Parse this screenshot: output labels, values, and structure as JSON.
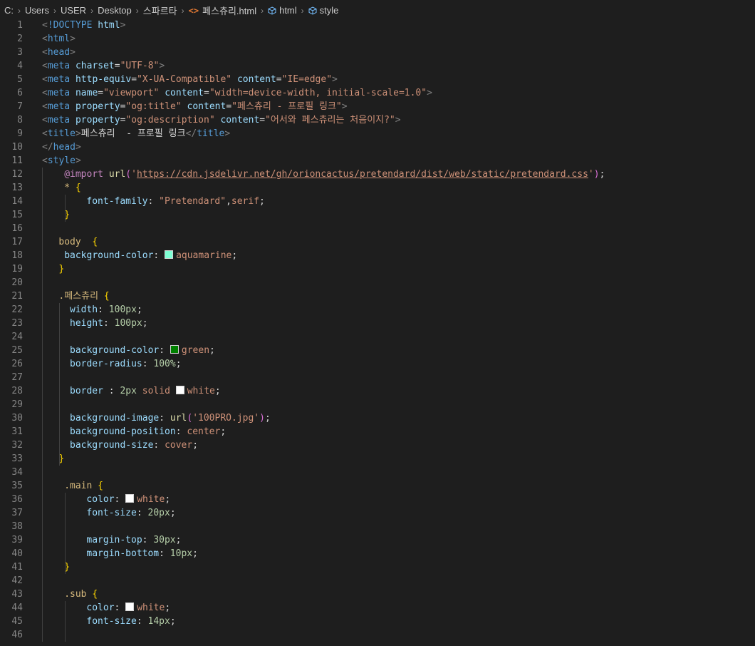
{
  "breadcrumb": {
    "items": [
      "C:",
      "Users",
      "USER",
      "Desktop",
      "스파르타",
      "페스츄리.html",
      "html",
      "style"
    ]
  },
  "colors": {
    "aquamarine": "#7fffd4",
    "green": "#008000",
    "white": "#ffffff"
  },
  "editor": {
    "lines": [
      {
        "n": "1",
        "indent": 0,
        "tokens": [
          [
            "t-tag",
            "<"
          ],
          [
            "t-tname",
            "!DOCTYPE"
          ],
          [
            "t-text",
            " "
          ],
          [
            "t-attr",
            "html"
          ],
          [
            "t-tag",
            ">"
          ]
        ]
      },
      {
        "n": "2",
        "indent": 0,
        "tokens": [
          [
            "t-tag",
            "<"
          ],
          [
            "t-tname",
            "html"
          ],
          [
            "t-tag",
            ">"
          ]
        ]
      },
      {
        "n": "3",
        "indent": 0,
        "tokens": [
          [
            "t-tag",
            "<"
          ],
          [
            "t-tname",
            "head"
          ],
          [
            "t-tag",
            ">"
          ]
        ]
      },
      {
        "n": "4",
        "indent": 0,
        "tokens": [
          [
            "t-tag",
            "<"
          ],
          [
            "t-tname",
            "meta"
          ],
          [
            "t-text",
            " "
          ],
          [
            "t-attr",
            "charset"
          ],
          [
            "t-text",
            "="
          ],
          [
            "t-str",
            "\"UTF-8\""
          ],
          [
            "t-tag",
            ">"
          ]
        ]
      },
      {
        "n": "5",
        "indent": 0,
        "tokens": [
          [
            "t-tag",
            "<"
          ],
          [
            "t-tname",
            "meta"
          ],
          [
            "t-text",
            " "
          ],
          [
            "t-attr",
            "http-equiv"
          ],
          [
            "t-text",
            "="
          ],
          [
            "t-str",
            "\"X-UA-Compatible\""
          ],
          [
            "t-text",
            " "
          ],
          [
            "t-attr",
            "content"
          ],
          [
            "t-text",
            "="
          ],
          [
            "t-str",
            "\"IE=edge\""
          ],
          [
            "t-tag",
            ">"
          ]
        ]
      },
      {
        "n": "6",
        "indent": 0,
        "tokens": [
          [
            "t-tag",
            "<"
          ],
          [
            "t-tname",
            "meta"
          ],
          [
            "t-text",
            " "
          ],
          [
            "t-attr",
            "name"
          ],
          [
            "t-text",
            "="
          ],
          [
            "t-str",
            "\"viewport\""
          ],
          [
            "t-text",
            " "
          ],
          [
            "t-attr",
            "content"
          ],
          [
            "t-text",
            "="
          ],
          [
            "t-str",
            "\"width=device-width, initial-scale=1.0\""
          ],
          [
            "t-tag",
            ">"
          ]
        ]
      },
      {
        "n": "7",
        "indent": 0,
        "tokens": [
          [
            "t-tag",
            "<"
          ],
          [
            "t-tname",
            "meta"
          ],
          [
            "t-text",
            " "
          ],
          [
            "t-attr",
            "property"
          ],
          [
            "t-text",
            "="
          ],
          [
            "t-str",
            "\"og:title\""
          ],
          [
            "t-text",
            " "
          ],
          [
            "t-attr",
            "content"
          ],
          [
            "t-text",
            "="
          ],
          [
            "t-str",
            "\"페스츄리 - 프로필 링크\""
          ],
          [
            "t-tag",
            ">"
          ]
        ]
      },
      {
        "n": "8",
        "indent": 0,
        "tokens": [
          [
            "t-tag",
            "<"
          ],
          [
            "t-tname",
            "meta"
          ],
          [
            "t-text",
            " "
          ],
          [
            "t-attr",
            "property"
          ],
          [
            "t-text",
            "="
          ],
          [
            "t-str",
            "\"og:description\""
          ],
          [
            "t-text",
            " "
          ],
          [
            "t-attr",
            "content"
          ],
          [
            "t-text",
            "="
          ],
          [
            "t-str",
            "\"어서와 페스츄리는 처음이지?\""
          ],
          [
            "t-tag",
            ">"
          ]
        ]
      },
      {
        "n": "9",
        "indent": 0,
        "tokens": [
          [
            "t-tag",
            "<"
          ],
          [
            "t-tname",
            "title"
          ],
          [
            "t-tag",
            ">"
          ],
          [
            "t-text",
            "페스츄리  - 프로필 링크"
          ],
          [
            "t-tag",
            "</"
          ],
          [
            "t-tname",
            "title"
          ],
          [
            "t-tag",
            ">"
          ]
        ]
      },
      {
        "n": "10",
        "indent": 0,
        "tokens": [
          [
            "t-tag",
            "</"
          ],
          [
            "t-tname",
            "head"
          ],
          [
            "t-tag",
            ">"
          ]
        ]
      },
      {
        "n": "11",
        "indent": 0,
        "tokens": [
          [
            "t-tag",
            "<"
          ],
          [
            "t-tname",
            "style"
          ],
          [
            "t-tag",
            ">"
          ]
        ]
      },
      {
        "n": "12",
        "indent": 4,
        "tokens": [
          [
            "t-at",
            "@import"
          ],
          [
            "t-text",
            " "
          ],
          [
            "t-fn",
            "url"
          ],
          [
            "t-brace2",
            "("
          ],
          [
            "t-str",
            "'"
          ],
          [
            "t-url",
            "https://cdn.jsdelivr.net/gh/orioncactus/pretendard/dist/web/static/pretendard.css"
          ],
          [
            "t-str",
            "'"
          ],
          [
            "t-brace2",
            ")"
          ],
          [
            "t-punc",
            ";"
          ]
        ]
      },
      {
        "n": "13",
        "indent": 4,
        "tokens": [
          [
            "t-star",
            "*"
          ],
          [
            "t-text",
            " "
          ],
          [
            "t-brace",
            "{"
          ]
        ]
      },
      {
        "n": "14",
        "indent": 8,
        "tokens": [
          [
            "t-prop",
            "font-family"
          ],
          [
            "t-punc",
            ": "
          ],
          [
            "t-val",
            "\"Pretendard\""
          ],
          [
            "t-punc",
            ","
          ],
          [
            "t-val",
            "serif"
          ],
          [
            "t-punc",
            ";"
          ]
        ]
      },
      {
        "n": "15",
        "indent": 4,
        "tokens": [
          [
            "t-brace",
            "}"
          ]
        ]
      },
      {
        "n": "16",
        "indent": 0,
        "tokens": []
      },
      {
        "n": "17",
        "indent": 3,
        "tokens": [
          [
            "t-sel",
            "body"
          ],
          [
            "t-text",
            "  "
          ],
          [
            "t-brace",
            "{"
          ]
        ]
      },
      {
        "n": "18",
        "indent": 4,
        "tokens": [
          [
            "t-prop",
            "background-color"
          ],
          [
            "t-punc",
            ": "
          ],
          [
            "swatch",
            "aquamarine"
          ],
          [
            "t-val",
            "aquamarine"
          ],
          [
            "t-punc",
            ";"
          ]
        ]
      },
      {
        "n": "19",
        "indent": 3,
        "tokens": [
          [
            "t-brace",
            "}"
          ]
        ]
      },
      {
        "n": "20",
        "indent": 0,
        "tokens": []
      },
      {
        "n": "21",
        "indent": 3,
        "tokens": [
          [
            "t-sel",
            ".페스츄리"
          ],
          [
            "t-text",
            " "
          ],
          [
            "t-brace",
            "{"
          ]
        ]
      },
      {
        "n": "22",
        "indent": 5,
        "tokens": [
          [
            "t-prop",
            "width"
          ],
          [
            "t-punc",
            ": "
          ],
          [
            "t-num",
            "100px"
          ],
          [
            "t-punc",
            ";"
          ]
        ]
      },
      {
        "n": "23",
        "indent": 5,
        "tokens": [
          [
            "t-prop",
            "height"
          ],
          [
            "t-punc",
            ": "
          ],
          [
            "t-num",
            "100px"
          ],
          [
            "t-punc",
            ";"
          ]
        ]
      },
      {
        "n": "24",
        "indent": 0,
        "tokens": []
      },
      {
        "n": "25",
        "indent": 5,
        "tokens": [
          [
            "t-prop",
            "background-color"
          ],
          [
            "t-punc",
            ": "
          ],
          [
            "swatch",
            "green"
          ],
          [
            "t-val",
            "green"
          ],
          [
            "t-punc",
            ";"
          ]
        ]
      },
      {
        "n": "26",
        "indent": 5,
        "tokens": [
          [
            "t-prop",
            "border-radius"
          ],
          [
            "t-punc",
            ": "
          ],
          [
            "t-num",
            "100%"
          ],
          [
            "t-punc",
            ";"
          ]
        ]
      },
      {
        "n": "27",
        "indent": 0,
        "tokens": []
      },
      {
        "n": "28",
        "indent": 5,
        "tokens": [
          [
            "t-prop",
            "border"
          ],
          [
            "t-punc",
            " : "
          ],
          [
            "t-num",
            "2px"
          ],
          [
            "t-text",
            " "
          ],
          [
            "t-val",
            "solid"
          ],
          [
            "t-text",
            " "
          ],
          [
            "swatch",
            "white"
          ],
          [
            "t-val",
            "white"
          ],
          [
            "t-punc",
            ";"
          ]
        ]
      },
      {
        "n": "29",
        "indent": 0,
        "tokens": []
      },
      {
        "n": "30",
        "indent": 5,
        "tokens": [
          [
            "t-prop",
            "background-image"
          ],
          [
            "t-punc",
            ": "
          ],
          [
            "t-fn",
            "url"
          ],
          [
            "t-brace2",
            "("
          ],
          [
            "t-str",
            "'100PRO.jpg'"
          ],
          [
            "t-brace2",
            ")"
          ],
          [
            "t-punc",
            ";"
          ]
        ]
      },
      {
        "n": "31",
        "indent": 5,
        "tokens": [
          [
            "t-prop",
            "background-position"
          ],
          [
            "t-punc",
            ": "
          ],
          [
            "t-val",
            "center"
          ],
          [
            "t-punc",
            ";"
          ]
        ]
      },
      {
        "n": "32",
        "indent": 5,
        "tokens": [
          [
            "t-prop",
            "background-size"
          ],
          [
            "t-punc",
            ": "
          ],
          [
            "t-val",
            "cover"
          ],
          [
            "t-punc",
            ";"
          ]
        ]
      },
      {
        "n": "33",
        "indent": 3,
        "tokens": [
          [
            "t-brace",
            "}"
          ]
        ]
      },
      {
        "n": "34",
        "indent": 0,
        "tokens": []
      },
      {
        "n": "35",
        "indent": 4,
        "tokens": [
          [
            "t-sel",
            ".main"
          ],
          [
            "t-text",
            " "
          ],
          [
            "t-brace",
            "{"
          ]
        ]
      },
      {
        "n": "36",
        "indent": 8,
        "tokens": [
          [
            "t-prop",
            "color"
          ],
          [
            "t-punc",
            ": "
          ],
          [
            "swatch",
            "white"
          ],
          [
            "t-val",
            "white"
          ],
          [
            "t-punc",
            ";"
          ]
        ]
      },
      {
        "n": "37",
        "indent": 8,
        "tokens": [
          [
            "t-prop",
            "font-size"
          ],
          [
            "t-punc",
            ": "
          ],
          [
            "t-num",
            "20px"
          ],
          [
            "t-punc",
            ";"
          ]
        ]
      },
      {
        "n": "38",
        "indent": 0,
        "tokens": []
      },
      {
        "n": "39",
        "indent": 8,
        "tokens": [
          [
            "t-prop",
            "margin-top"
          ],
          [
            "t-punc",
            ": "
          ],
          [
            "t-num",
            "30px"
          ],
          [
            "t-punc",
            ";"
          ]
        ]
      },
      {
        "n": "40",
        "indent": 8,
        "tokens": [
          [
            "t-prop",
            "margin-bottom"
          ],
          [
            "t-punc",
            ": "
          ],
          [
            "t-num",
            "10px"
          ],
          [
            "t-punc",
            ";"
          ]
        ]
      },
      {
        "n": "41",
        "indent": 4,
        "tokens": [
          [
            "t-brace",
            "}"
          ]
        ]
      },
      {
        "n": "42",
        "indent": 0,
        "tokens": []
      },
      {
        "n": "43",
        "indent": 4,
        "tokens": [
          [
            "t-sel",
            ".sub"
          ],
          [
            "t-text",
            " "
          ],
          [
            "t-brace",
            "{"
          ]
        ]
      },
      {
        "n": "44",
        "indent": 8,
        "tokens": [
          [
            "t-prop",
            "color"
          ],
          [
            "t-punc",
            ": "
          ],
          [
            "swatch",
            "white"
          ],
          [
            "t-val",
            "white"
          ],
          [
            "t-punc",
            ";"
          ]
        ]
      },
      {
        "n": "45",
        "indent": 8,
        "tokens": [
          [
            "t-prop",
            "font-size"
          ],
          [
            "t-punc",
            ": "
          ],
          [
            "t-num",
            "14px"
          ],
          [
            "t-punc",
            ";"
          ]
        ]
      },
      {
        "n": "46",
        "indent": 0,
        "tokens": []
      }
    ]
  }
}
